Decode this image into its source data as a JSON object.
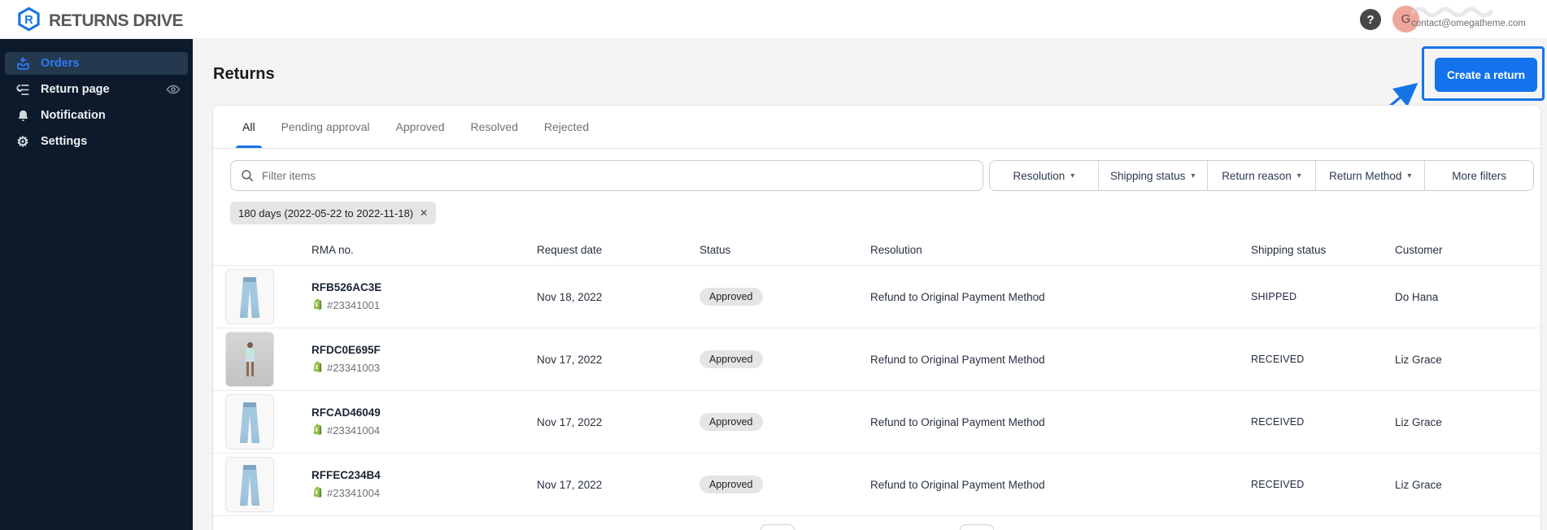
{
  "header": {
    "brand": "RETURNS DRIVE",
    "help_icon": "?",
    "avatar_initial": "G",
    "user_email": "contact@omegatheme.com"
  },
  "sidebar": {
    "items": [
      {
        "label": "Orders",
        "icon": "orders-icon",
        "active": true
      },
      {
        "label": "Return page",
        "icon": "return-page-icon",
        "trailing_icon": "eye-icon"
      },
      {
        "label": "Notification",
        "icon": "bell-icon"
      },
      {
        "label": "Settings",
        "icon": "gear-icon"
      }
    ]
  },
  "page": {
    "title": "Returns",
    "create_return_label": "Create a return"
  },
  "tabs": {
    "items": [
      "All",
      "Pending approval",
      "Approved",
      "Resolved",
      "Rejected"
    ],
    "active": "All"
  },
  "filters": {
    "search_placeholder": "Filter items",
    "dropdowns": [
      "Resolution",
      "Shipping status",
      "Return reason",
      "Return Method"
    ],
    "more_filters_label": "More filters",
    "date_chip": "180 days (2022-05-22 to 2022-11-18)"
  },
  "icons": {
    "caret": "▾",
    "close": "✕",
    "gear": "⚙"
  },
  "table": {
    "headers": [
      "RMA no.",
      "Request date",
      "Status",
      "Resolution",
      "Shipping status",
      "Customer"
    ],
    "rows": [
      {
        "rma": "RFB526AC3E",
        "order_number": "#23341001",
        "request_date": "Nov 18, 2022",
        "status": "Approved",
        "resolution": "Refund to Original Payment Method",
        "shipping_status": "SHIPPED",
        "customer": "Do Hana",
        "product_image": "jeans-product-image"
      },
      {
        "rma": "RFDC0E695F",
        "order_number": "#23341003",
        "request_date": "Nov 17, 2022",
        "status": "Approved",
        "resolution": "Refund to Original Payment Method",
        "shipping_status": "RECEIVED",
        "customer": "Liz Grace",
        "product_image": "model-product-image"
      },
      {
        "rma": "RFCAD46049",
        "order_number": "#23341004",
        "request_date": "Nov 17, 2022",
        "status": "Approved",
        "resolution": "Refund to Original Payment Method",
        "shipping_status": "RECEIVED",
        "customer": "Liz Grace",
        "product_image": "jeans-product-image"
      },
      {
        "rma": "RFFEC234B4",
        "order_number": "#23341004",
        "request_date": "Nov 17, 2022",
        "status": "Approved",
        "resolution": "Refund to Original Payment Method",
        "shipping_status": "RECEIVED",
        "customer": "Liz Grace",
        "product_image": "jeans-product-image"
      }
    ]
  },
  "colors": {
    "accent_blue": "#1673e6",
    "button_blue": "#1372ec",
    "sidebar_bg": "#0c1a2b",
    "sidebar_active_bg": "#24384e",
    "badge_bg": "#e4e5e7",
    "shopify_green": "#95bf47",
    "avatar_bg": "#f0a79b"
  }
}
